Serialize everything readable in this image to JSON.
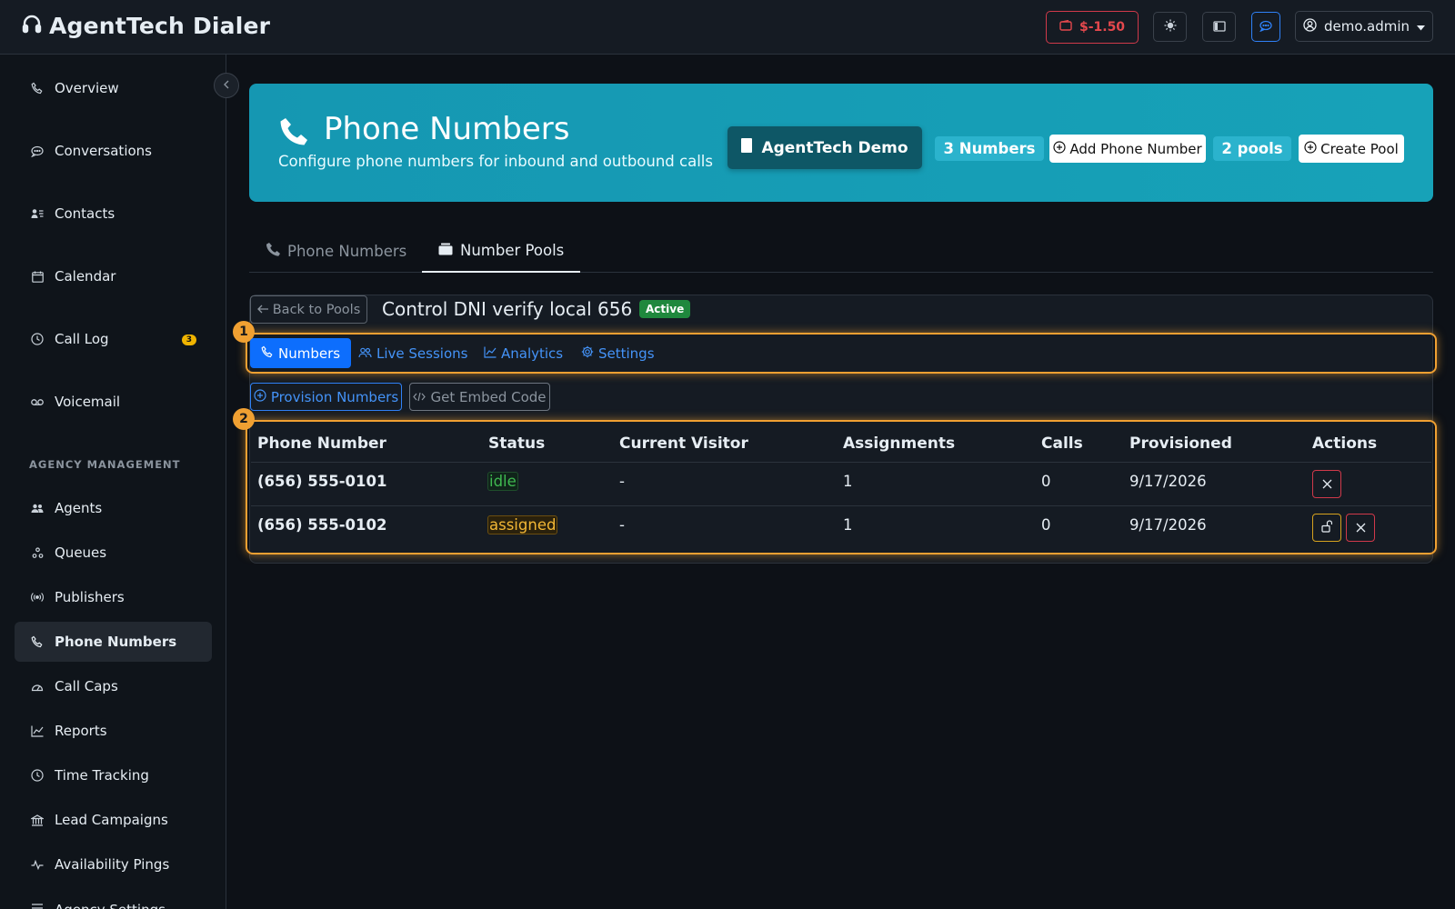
{
  "app": {
    "title": "AgentTech Dialer",
    "balance": "$-1.50",
    "user": "demo.admin"
  },
  "sidebar": {
    "items": [
      {
        "label": "Overview",
        "icon": "phone-icon"
      },
      {
        "label": "Conversations",
        "icon": "chat-icon"
      },
      {
        "label": "Contacts",
        "icon": "contacts-icon"
      },
      {
        "label": "Calendar",
        "icon": "calendar-icon"
      },
      {
        "label": "Call Log",
        "icon": "clock-icon",
        "badge": "3"
      },
      {
        "label": "Voicemail",
        "icon": "voicemail-icon"
      }
    ],
    "section_label": "AGENCY MANAGEMENT",
    "agency_items": [
      {
        "label": "Agents",
        "icon": "people-icon"
      },
      {
        "label": "Queues",
        "icon": "queue-icon"
      },
      {
        "label": "Publishers",
        "icon": "broadcast-icon"
      },
      {
        "label": "Phone Numbers",
        "icon": "phone-icon",
        "active": true
      },
      {
        "label": "Call Caps",
        "icon": "gauge-icon"
      },
      {
        "label": "Reports",
        "icon": "chart-icon"
      },
      {
        "label": "Time Tracking",
        "icon": "clock-icon"
      },
      {
        "label": "Lead Campaigns",
        "icon": "bank-icon"
      },
      {
        "label": "Availability Pings",
        "icon": "pulse-icon"
      },
      {
        "label": "Agency Settings",
        "icon": "settings-icon"
      }
    ]
  },
  "banner": {
    "title": "Phone Numbers",
    "subtitle": "Configure phone numbers for inbound and outbound calls",
    "org": "AgentTech Demo",
    "numbers_count": "3 Numbers",
    "add_number": "Add Phone Number",
    "pools_count": "2 pools",
    "create_pool": "Create Pool"
  },
  "tabs": [
    {
      "label": "Phone Numbers",
      "active": false
    },
    {
      "label": "Number Pools",
      "active": true
    }
  ],
  "pool": {
    "back": "Back to Pools",
    "title": "Control DNI verify local 656",
    "status": "Active",
    "subtabs": [
      {
        "label": "Numbers",
        "active": true
      },
      {
        "label": "Live Sessions"
      },
      {
        "label": "Analytics"
      },
      {
        "label": "Settings"
      }
    ],
    "provision": "Provision Numbers",
    "embed": "Get Embed Code",
    "highlights": [
      "1",
      "2"
    ],
    "columns": [
      "Phone Number",
      "Status",
      "Current Visitor",
      "Assignments",
      "Calls",
      "Provisioned",
      "Actions"
    ],
    "rows": [
      {
        "number": "(656) 555-0101",
        "status": "idle",
        "visitor": "-",
        "assignments": "1",
        "calls": "0",
        "provisioned": "9/17/2026"
      },
      {
        "number": "(656) 555-0102",
        "status": "assigned",
        "visitor": "-",
        "assignments": "1",
        "calls": "0",
        "provisioned": "9/17/2026"
      }
    ]
  },
  "colors": {
    "accent": "#0d6efd",
    "banner": "#17a2b8",
    "highlight": "#f0a032",
    "danger": "#e5484d",
    "warning": "#f2b735",
    "success": "#3fb950"
  }
}
